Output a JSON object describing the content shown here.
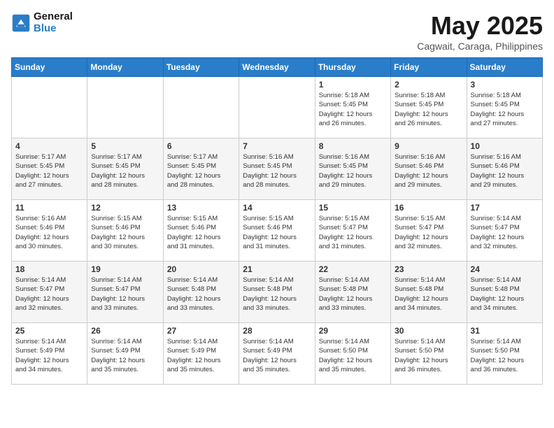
{
  "header": {
    "logo_line1": "General",
    "logo_line2": "Blue",
    "month": "May 2025",
    "location": "Cagwait, Caraga, Philippines"
  },
  "weekdays": [
    "Sunday",
    "Monday",
    "Tuesday",
    "Wednesday",
    "Thursday",
    "Friday",
    "Saturday"
  ],
  "weeks": [
    [
      {
        "day": "",
        "info": ""
      },
      {
        "day": "",
        "info": ""
      },
      {
        "day": "",
        "info": ""
      },
      {
        "day": "",
        "info": ""
      },
      {
        "day": "1",
        "info": "Sunrise: 5:18 AM\nSunset: 5:45 PM\nDaylight: 12 hours\nand 26 minutes."
      },
      {
        "day": "2",
        "info": "Sunrise: 5:18 AM\nSunset: 5:45 PM\nDaylight: 12 hours\nand 26 minutes."
      },
      {
        "day": "3",
        "info": "Sunrise: 5:18 AM\nSunset: 5:45 PM\nDaylight: 12 hours\nand 27 minutes."
      }
    ],
    [
      {
        "day": "4",
        "info": "Sunrise: 5:17 AM\nSunset: 5:45 PM\nDaylight: 12 hours\nand 27 minutes."
      },
      {
        "day": "5",
        "info": "Sunrise: 5:17 AM\nSunset: 5:45 PM\nDaylight: 12 hours\nand 28 minutes."
      },
      {
        "day": "6",
        "info": "Sunrise: 5:17 AM\nSunset: 5:45 PM\nDaylight: 12 hours\nand 28 minutes."
      },
      {
        "day": "7",
        "info": "Sunrise: 5:16 AM\nSunset: 5:45 PM\nDaylight: 12 hours\nand 28 minutes."
      },
      {
        "day": "8",
        "info": "Sunrise: 5:16 AM\nSunset: 5:45 PM\nDaylight: 12 hours\nand 29 minutes."
      },
      {
        "day": "9",
        "info": "Sunrise: 5:16 AM\nSunset: 5:46 PM\nDaylight: 12 hours\nand 29 minutes."
      },
      {
        "day": "10",
        "info": "Sunrise: 5:16 AM\nSunset: 5:46 PM\nDaylight: 12 hours\nand 29 minutes."
      }
    ],
    [
      {
        "day": "11",
        "info": "Sunrise: 5:16 AM\nSunset: 5:46 PM\nDaylight: 12 hours\nand 30 minutes."
      },
      {
        "day": "12",
        "info": "Sunrise: 5:15 AM\nSunset: 5:46 PM\nDaylight: 12 hours\nand 30 minutes."
      },
      {
        "day": "13",
        "info": "Sunrise: 5:15 AM\nSunset: 5:46 PM\nDaylight: 12 hours\nand 31 minutes."
      },
      {
        "day": "14",
        "info": "Sunrise: 5:15 AM\nSunset: 5:46 PM\nDaylight: 12 hours\nand 31 minutes."
      },
      {
        "day": "15",
        "info": "Sunrise: 5:15 AM\nSunset: 5:47 PM\nDaylight: 12 hours\nand 31 minutes."
      },
      {
        "day": "16",
        "info": "Sunrise: 5:15 AM\nSunset: 5:47 PM\nDaylight: 12 hours\nand 32 minutes."
      },
      {
        "day": "17",
        "info": "Sunrise: 5:14 AM\nSunset: 5:47 PM\nDaylight: 12 hours\nand 32 minutes."
      }
    ],
    [
      {
        "day": "18",
        "info": "Sunrise: 5:14 AM\nSunset: 5:47 PM\nDaylight: 12 hours\nand 32 minutes."
      },
      {
        "day": "19",
        "info": "Sunrise: 5:14 AM\nSunset: 5:47 PM\nDaylight: 12 hours\nand 33 minutes."
      },
      {
        "day": "20",
        "info": "Sunrise: 5:14 AM\nSunset: 5:48 PM\nDaylight: 12 hours\nand 33 minutes."
      },
      {
        "day": "21",
        "info": "Sunrise: 5:14 AM\nSunset: 5:48 PM\nDaylight: 12 hours\nand 33 minutes."
      },
      {
        "day": "22",
        "info": "Sunrise: 5:14 AM\nSunset: 5:48 PM\nDaylight: 12 hours\nand 33 minutes."
      },
      {
        "day": "23",
        "info": "Sunrise: 5:14 AM\nSunset: 5:48 PM\nDaylight: 12 hours\nand 34 minutes."
      },
      {
        "day": "24",
        "info": "Sunrise: 5:14 AM\nSunset: 5:48 PM\nDaylight: 12 hours\nand 34 minutes."
      }
    ],
    [
      {
        "day": "25",
        "info": "Sunrise: 5:14 AM\nSunset: 5:49 PM\nDaylight: 12 hours\nand 34 minutes."
      },
      {
        "day": "26",
        "info": "Sunrise: 5:14 AM\nSunset: 5:49 PM\nDaylight: 12 hours\nand 35 minutes."
      },
      {
        "day": "27",
        "info": "Sunrise: 5:14 AM\nSunset: 5:49 PM\nDaylight: 12 hours\nand 35 minutes."
      },
      {
        "day": "28",
        "info": "Sunrise: 5:14 AM\nSunset: 5:49 PM\nDaylight: 12 hours\nand 35 minutes."
      },
      {
        "day": "29",
        "info": "Sunrise: 5:14 AM\nSunset: 5:50 PM\nDaylight: 12 hours\nand 35 minutes."
      },
      {
        "day": "30",
        "info": "Sunrise: 5:14 AM\nSunset: 5:50 PM\nDaylight: 12 hours\nand 36 minutes."
      },
      {
        "day": "31",
        "info": "Sunrise: 5:14 AM\nSunset: 5:50 PM\nDaylight: 12 hours\nand 36 minutes."
      }
    ]
  ]
}
